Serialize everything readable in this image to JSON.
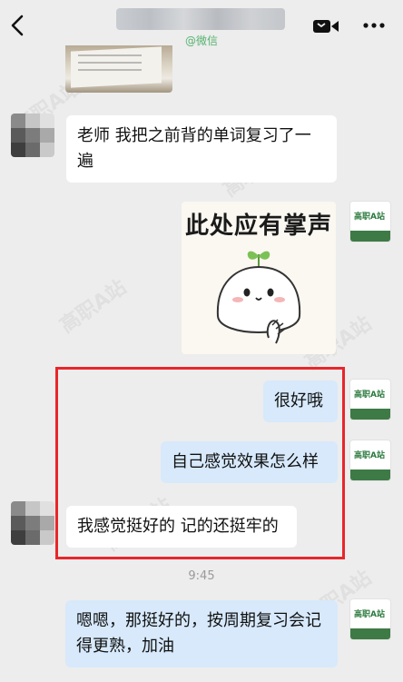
{
  "header": {
    "subtitle": "@微信",
    "back_icon": "chevron-left-icon",
    "call_icon": "video-call-icon",
    "more_icon": "more-dots-icon"
  },
  "messages": [
    {
      "side": "left",
      "type": "text",
      "text": "老师 我把之前背的单词复习了一遍"
    },
    {
      "side": "right",
      "type": "sticker",
      "text": "此处应有掌声"
    },
    {
      "side": "right",
      "type": "text",
      "text": "很好哦"
    },
    {
      "side": "right",
      "type": "text",
      "text": "自己感觉效果怎么样"
    },
    {
      "side": "left",
      "type": "text",
      "text": "我感觉挺好的 记的还挺牢的"
    },
    {
      "side": "center",
      "type": "time",
      "text": "9:45"
    },
    {
      "side": "right",
      "type": "text",
      "text": "嗯嗯，那挺好的，按周期复习会记得更熟，加油"
    }
  ],
  "avatar_logo": "高职A站",
  "watermark": "高职A站",
  "highlight_color": "#e8262b",
  "colors": {
    "background": "#ededed",
    "bubble_left": "#ffffff",
    "bubble_right": "#d7e9fb",
    "accent_green": "#56b26f"
  }
}
